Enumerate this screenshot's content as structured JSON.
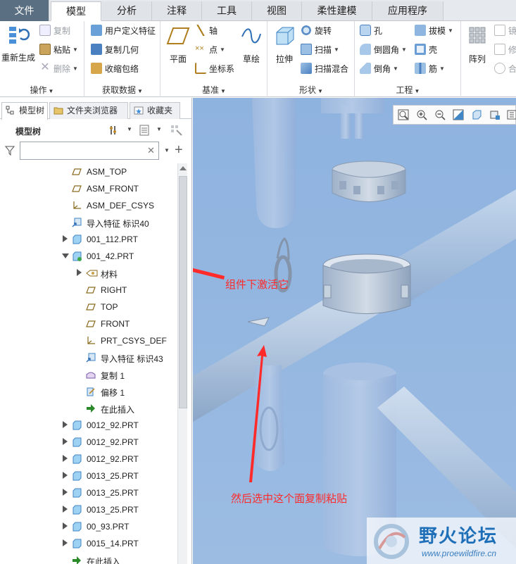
{
  "tabs": [
    "文件",
    "模型",
    "分析",
    "注释",
    "工具",
    "视图",
    "柔性建模",
    "应用程序"
  ],
  "active_tab": "模型",
  "ribbon": {
    "operations": {
      "label": "操作",
      "regen": "重新生成",
      "copy": "复制",
      "paste": "粘贴",
      "delete": "删除"
    },
    "get_data": {
      "label": "获取数据",
      "udf": "用户定义特征",
      "copy_geom": "复制几何",
      "shrinkwrap": "收缩包络"
    },
    "datum": {
      "label": "基准",
      "plane": "平面",
      "axis": "轴",
      "point": "点",
      "csys": "坐标系",
      "sketch": "草绘"
    },
    "shapes": {
      "label": "形状",
      "extrude": "拉伸",
      "revolve": "旋转",
      "sweep": "扫描",
      "swept_blend": "扫描混合"
    },
    "engineering": {
      "label": "工程",
      "hole": "孔",
      "round": "倒圆角",
      "chamfer": "倒角",
      "draft": "拔模",
      "shell": "壳",
      "rib": "筋"
    },
    "editing": {
      "pattern": "阵列",
      "mirror": "镜",
      "modify": "修",
      "merge": "合"
    }
  },
  "panel_tabs": [
    "模型树",
    "文件夹浏览器",
    "收藏夹"
  ],
  "tree_title": "模型树",
  "filter_placeholder": "",
  "tree_items": [
    {
      "label": "ASM_TOP",
      "icon": "datum-plane-icon",
      "level": 1,
      "expand": ""
    },
    {
      "label": "ASM_FRONT",
      "icon": "datum-plane-icon",
      "level": 1,
      "expand": ""
    },
    {
      "label": "ASM_DEF_CSYS",
      "icon": "csys-icon",
      "level": 1,
      "expand": ""
    },
    {
      "label": "导入特征 标识40",
      "icon": "import-feature-icon",
      "level": 1,
      "expand": ""
    },
    {
      "label": "001_112.PRT",
      "icon": "part-icon",
      "level": 1,
      "expand": "right"
    },
    {
      "label": "001_42.PRT",
      "icon": "active-part-icon",
      "level": 1,
      "expand": "down"
    },
    {
      "label": "材料",
      "icon": "material-icon",
      "level": 2,
      "expand": "right"
    },
    {
      "label": "RIGHT",
      "icon": "datum-plane-icon",
      "level": 2,
      "expand": ""
    },
    {
      "label": "TOP",
      "icon": "datum-plane-icon",
      "level": 2,
      "expand": ""
    },
    {
      "label": "FRONT",
      "icon": "datum-plane-icon",
      "level": 2,
      "expand": ""
    },
    {
      "label": "PRT_CSYS_DEF",
      "icon": "csys-icon",
      "level": 2,
      "expand": ""
    },
    {
      "label": "导入特征 标识43",
      "icon": "import-feature-icon",
      "level": 2,
      "expand": ""
    },
    {
      "label": "复制 1",
      "icon": "copy-surface-icon",
      "level": 2,
      "expand": ""
    },
    {
      "label": "偏移 1",
      "icon": "offset-icon",
      "level": 2,
      "expand": ""
    },
    {
      "label": "在此插入",
      "icon": "insert-here-icon",
      "level": 2,
      "expand": ""
    },
    {
      "label": "0012_92.PRT",
      "icon": "part-icon",
      "level": 1,
      "expand": "right"
    },
    {
      "label": "0012_92.PRT",
      "icon": "part-icon",
      "level": 1,
      "expand": "right"
    },
    {
      "label": "0012_92.PRT",
      "icon": "part-icon",
      "level": 1,
      "expand": "right"
    },
    {
      "label": "0013_25.PRT",
      "icon": "part-icon",
      "level": 1,
      "expand": "right"
    },
    {
      "label": "0013_25.PRT",
      "icon": "part-icon",
      "level": 1,
      "expand": "right"
    },
    {
      "label": "0013_25.PRT",
      "icon": "part-icon",
      "level": 1,
      "expand": "right"
    },
    {
      "label": "00_93.PRT",
      "icon": "part-icon",
      "level": 1,
      "expand": "right"
    },
    {
      "label": "0015_14.PRT",
      "icon": "part-icon",
      "level": 1,
      "expand": "right"
    },
    {
      "label": "在此插入",
      "icon": "insert-here-icon",
      "level": 1,
      "expand": ""
    }
  ],
  "annotations": {
    "activate": "组件下激活它",
    "copy_paste": "然后选中这个面复制粘贴"
  },
  "watermark": {
    "title": "野火论坛",
    "url": "www.proewildfire.cn"
  },
  "colors": {
    "viewport_bg": "#8fb3df",
    "annotation": "#ff2a2a",
    "file_tab": "#5b6f82",
    "watermark": "#1f6fb8"
  }
}
